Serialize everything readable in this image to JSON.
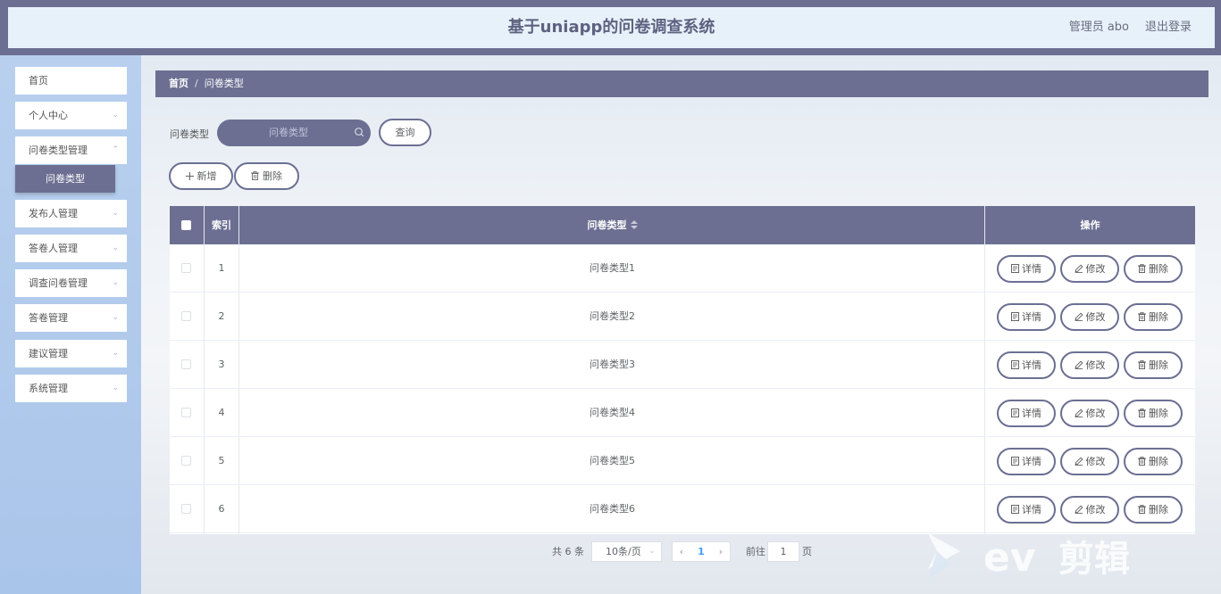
{
  "header": {
    "title": "基于uniapp的问卷调查系统",
    "user": "管理员 abo",
    "logout": "退出登录"
  },
  "sidebar": {
    "items": [
      {
        "label": "首页",
        "has_children": false
      },
      {
        "label": "个人中心",
        "has_children": true
      },
      {
        "label": "问卷类型管理",
        "has_children": true,
        "expanded": true
      },
      {
        "label": "发布人管理",
        "has_children": true
      },
      {
        "label": "答卷人管理",
        "has_children": true
      },
      {
        "label": "调查问卷管理",
        "has_children": true
      },
      {
        "label": "答卷管理",
        "has_children": true
      },
      {
        "label": "建议管理",
        "has_children": true
      },
      {
        "label": "系统管理",
        "has_children": true
      }
    ],
    "active_sub": "问卷类型"
  },
  "breadcrumb": {
    "home": "首页",
    "separator": "/",
    "current": "问卷类型"
  },
  "search": {
    "label": "问卷类型",
    "placeholder": "问卷类型",
    "query_button": "查询"
  },
  "actions": {
    "add": "新增",
    "delete": "删除"
  },
  "table": {
    "columns": {
      "index": "索引",
      "type": "问卷类型",
      "operation": "操作"
    },
    "rows": [
      {
        "index": "1",
        "type": "问卷类型1"
      },
      {
        "index": "2",
        "type": "问卷类型2"
      },
      {
        "index": "3",
        "type": "问卷类型3"
      },
      {
        "index": "4",
        "type": "问卷类型4"
      },
      {
        "index": "5",
        "type": "问卷类型5"
      },
      {
        "index": "6",
        "type": "问卷类型6"
      }
    ],
    "row_actions": {
      "detail": "详情",
      "edit": "修改",
      "delete": "删除"
    }
  },
  "pagination": {
    "total": "共 6 条",
    "page_size": "10条/页",
    "current_page": "1",
    "goto_label": "前往",
    "goto_value": "1",
    "page_suffix": "页"
  },
  "watermark": {
    "text": "ev剪辑"
  },
  "colors": {
    "primary": "#6c6f92",
    "header_bg": "#e7f1fa",
    "sidebar_bg": "#b8d0ee",
    "page_link": "#409eff"
  }
}
